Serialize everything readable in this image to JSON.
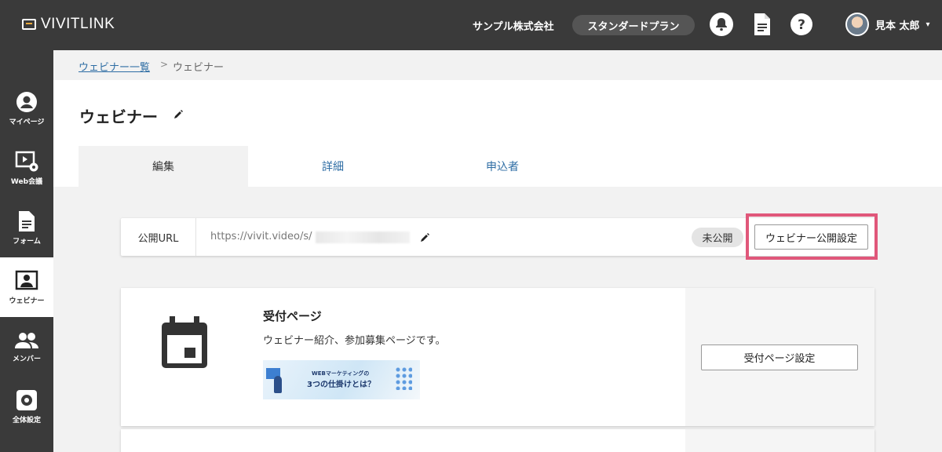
{
  "app": {
    "logo_text": "VIVITLINK"
  },
  "topbar": {
    "company": "サンプル株式会社",
    "plan": "スタンダードプラン",
    "user_name": "見本 太郎",
    "icons": [
      "bell-icon",
      "document-icon",
      "help-icon"
    ]
  },
  "sidebar": {
    "items": [
      {
        "label": "マイページ",
        "icon": "account-circle-icon"
      },
      {
        "label": "Web会議",
        "icon": "video-settings-icon"
      },
      {
        "label": "フォーム",
        "icon": "form-document-icon"
      },
      {
        "label": "ウェビナー",
        "icon": "webinar-icon",
        "active": true
      },
      {
        "label": "メンバー",
        "icon": "members-icon"
      },
      {
        "label": "全体設定",
        "icon": "settings-icon"
      }
    ]
  },
  "breadcrumb": {
    "parent": "ウェビナー一覧",
    "separator": ">",
    "current": "ウェビナー"
  },
  "page": {
    "title": "ウェビナー"
  },
  "tabs": [
    {
      "label": "編集",
      "active": true
    },
    {
      "label": "詳細"
    },
    {
      "label": "申込者"
    }
  ],
  "public_url": {
    "label": "公開URL",
    "value": "https://vivit.video/s/",
    "status": "未公開",
    "publish_button": "ウェビナー公開設定"
  },
  "reception": {
    "title": "受付ページ",
    "description": "ウェビナー紹介、参加募集ページです。",
    "banner_line1": "WEBマーケティングの",
    "banner_line2": "3つの仕掛けとは？",
    "button": "受付ページ設定"
  },
  "colors": {
    "topbar": "#3a3a3a",
    "link": "#2e6da4",
    "highlight": "#e0577a"
  }
}
